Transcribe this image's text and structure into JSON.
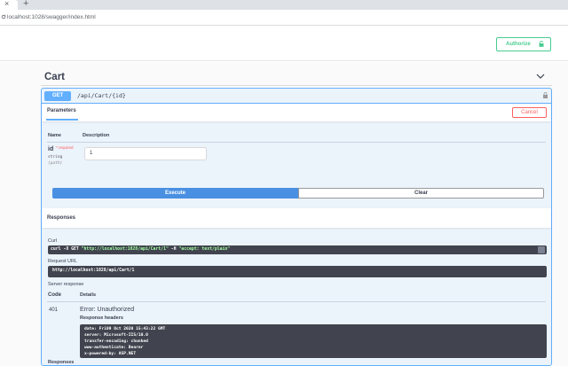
{
  "browser": {
    "tab_close": "×",
    "new_tab": "+",
    "url": "localhost:1028/swagger/index.html"
  },
  "auth": {
    "label": "Authorize",
    "color": "#49cc90"
  },
  "tag": {
    "title": "Cart"
  },
  "operation": {
    "method": "GET",
    "path": "/api/Cart/{id}",
    "method_color": "#61affe"
  },
  "parameters": {
    "tab_label": "Parameters",
    "cancel_label": "Cancel",
    "col_name": "Name",
    "col_description": "Description",
    "items": [
      {
        "name": "id",
        "required": "* required",
        "type": "string",
        "in": "(path)",
        "value": "1"
      }
    ]
  },
  "actions": {
    "execute_label": "Execute",
    "clear_label": "Clear"
  },
  "responses": {
    "title": "Responses",
    "curl_label": "Curl",
    "curl_cmd_prefix": "curl -X GET ",
    "curl_url": "\"http://localhost:1028/api/Cart/1\"",
    "curl_flag": " -H ",
    "curl_header": " \"accept: text/plain\"",
    "request_url_label": "Request URL",
    "request_url": "http://localhost:1028/api/Cart/1",
    "server_response_label": "Server response",
    "col_code": "Code",
    "col_details": "Details",
    "status_code": "401",
    "status_text": "Error: Unauthorized",
    "headers_label": "Response headers",
    "headers": [
      "date: Fri09 Oct 2020 15:43:22 GMT",
      "server: Microsoft-IIS/10.0",
      "transfer-encoding: chunked",
      "www-authenticate: Bearer",
      "x-powered-by: ASP.NET"
    ],
    "bottom_label": "Responses"
  }
}
